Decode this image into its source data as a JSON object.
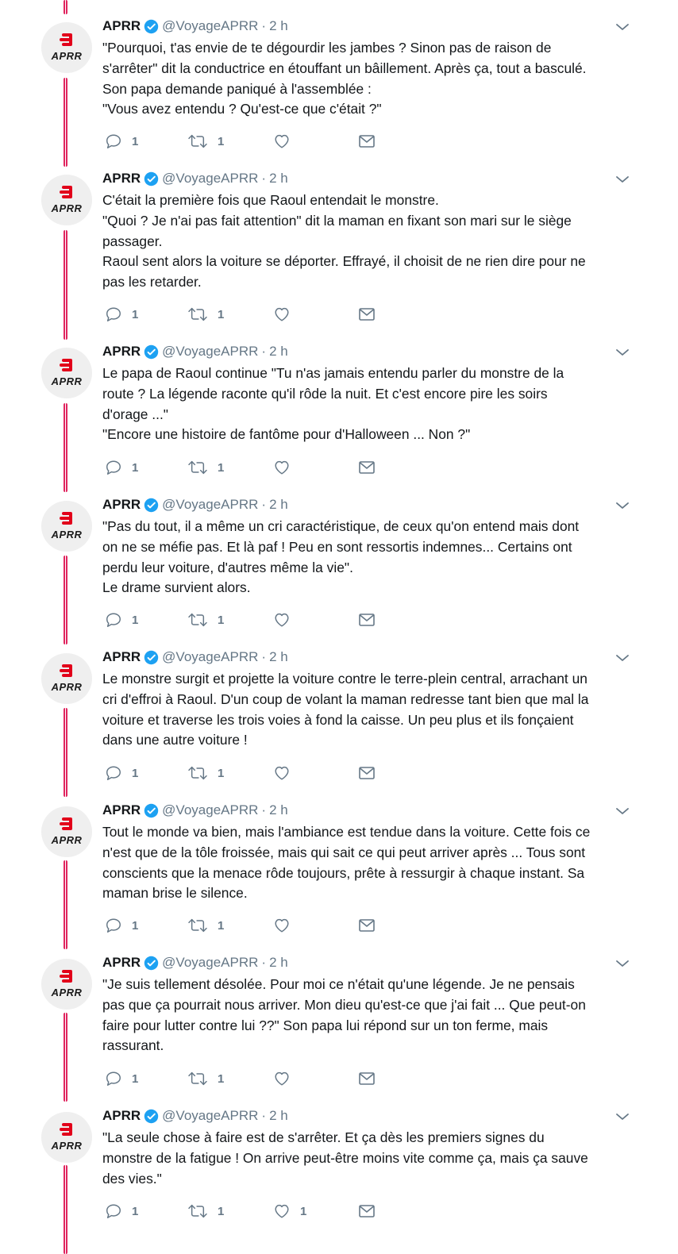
{
  "colors": {
    "thread": "#e0245e",
    "secondary": "#657786",
    "verified": "#1da1f2",
    "logo_red": "#e2001a"
  },
  "avatar_text": "APRR",
  "tweets": [
    {
      "name": "APRR",
      "handle": "@VoyageAPRR",
      "sep": "·",
      "time": "2 h",
      "lines": [
        "\"Pourquoi, t'as envie de te dégourdir les jambes ? Sinon pas de raison de",
        "s'arrêter\" dit la conductrice en étouffant un bâillement. Après ça, tout a basculé.",
        "Son papa demande paniqué à l'assemblée :",
        "\"Vous avez entendu ? Qu'est-ce que c'était ?\""
      ],
      "replies": "1",
      "retweets": "1",
      "likes": ""
    },
    {
      "name": "APRR",
      "handle": "@VoyageAPRR",
      "sep": "·",
      "time": "2 h",
      "lines": [
        "C'était la première fois que Raoul entendait le monstre.",
        "\"Quoi ? Je n'ai pas fait attention\" dit la maman en fixant son mari sur le siège",
        "passager.",
        "Raoul sent alors la voiture se déporter. Effrayé, il choisit de ne rien dire pour ne",
        "pas les retarder."
      ],
      "replies": "1",
      "retweets": "1",
      "likes": ""
    },
    {
      "name": "APRR",
      "handle": "@VoyageAPRR",
      "sep": "·",
      "time": "2 h",
      "lines": [
        "Le papa de Raoul continue \"Tu n'as jamais entendu parler du monstre de la",
        "route ? La légende raconte qu'il rôde la nuit. Et c'est encore pire les soirs",
        "d'orage ...\"",
        "\"Encore une histoire de fantôme pour d'Halloween ... Non ?\""
      ],
      "replies": "1",
      "retweets": "1",
      "likes": ""
    },
    {
      "name": "APRR",
      "handle": "@VoyageAPRR",
      "sep": "·",
      "time": "2 h",
      "lines": [
        "\"Pas du tout, il a même un cri caractéristique, de ceux qu'on entend mais dont",
        "on ne se méfie pas. Et là paf ! Peu en sont ressortis indemnes... Certains ont",
        "perdu leur voiture, d'autres même la vie\".",
        "Le drame survient alors."
      ],
      "replies": "1",
      "retweets": "1",
      "likes": ""
    },
    {
      "name": "APRR",
      "handle": "@VoyageAPRR",
      "sep": "·",
      "time": "2 h",
      "lines": [
        "Le monstre surgit et projette la voiture contre le terre-plein central, arrachant un",
        "cri d'effroi à Raoul. D'un coup de volant la maman redresse tant bien que mal la",
        "voiture et traverse les trois voies à fond la caisse. Un peu plus et ils fonçaient",
        "dans une autre voiture !"
      ],
      "replies": "1",
      "retweets": "1",
      "likes": ""
    },
    {
      "name": "APRR",
      "handle": "@VoyageAPRR",
      "sep": "·",
      "time": "2 h",
      "lines": [
        "Tout le monde va bien, mais l'ambiance est tendue dans la voiture. Cette fois ce",
        "n'est que de la tôle froissée, mais qui sait ce qui peut arriver après ... Tous sont",
        "conscients que la menace rôde toujours, prête à ressurgir à chaque instant. Sa",
        "maman brise le silence."
      ],
      "replies": "1",
      "retweets": "1",
      "likes": ""
    },
    {
      "name": "APRR",
      "handle": "@VoyageAPRR",
      "sep": "·",
      "time": "2 h",
      "lines": [
        "\"Je suis tellement désolée. Pour moi ce n'était qu'une légende. Je ne pensais",
        "pas que ça pourrait nous arriver. Mon dieu qu'est-ce que j'ai fait ... Que peut-on",
        "faire pour lutter contre lui ??\" Son papa lui répond sur un ton ferme, mais",
        "rassurant."
      ],
      "replies": "1",
      "retweets": "1",
      "likes": ""
    },
    {
      "name": "APRR",
      "handle": "@VoyageAPRR",
      "sep": "·",
      "time": "2 h",
      "lines": [
        "\"La seule chose à faire est de s'arrêter. Et ça dès les premiers signes du",
        "monstre de la fatigue ! On arrive peut-être moins vite comme ça, mais ça sauve",
        "des vies.\""
      ],
      "replies": "1",
      "retweets": "1",
      "likes": "1"
    }
  ]
}
